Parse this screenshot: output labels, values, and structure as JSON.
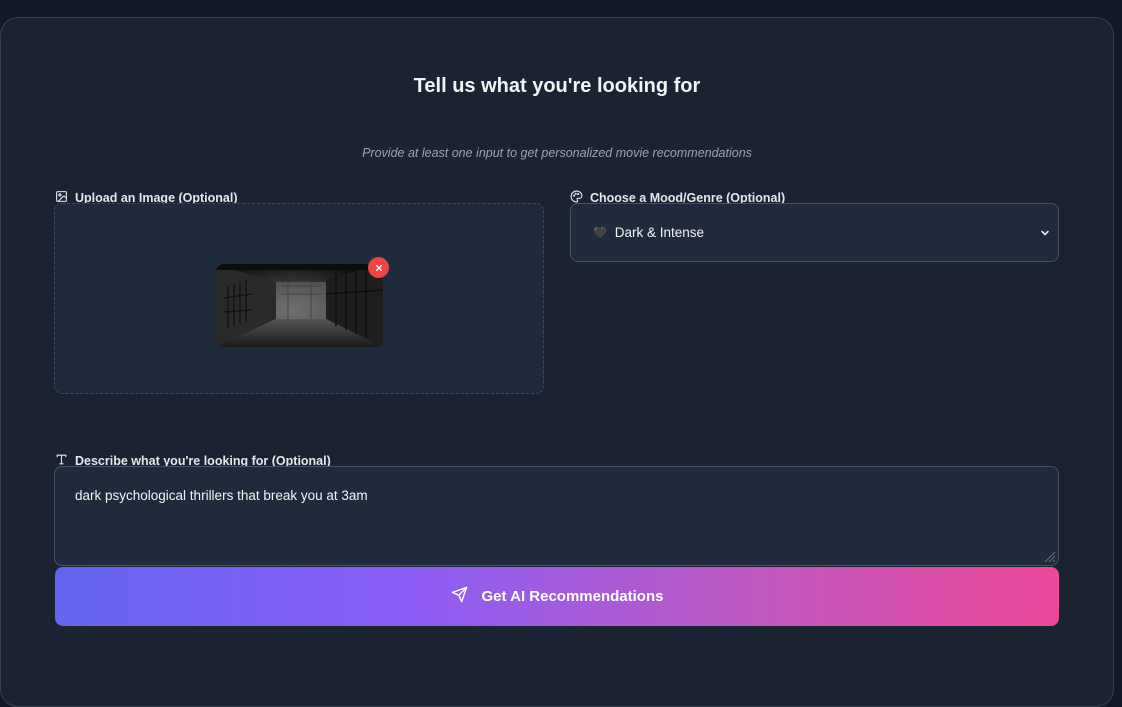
{
  "form": {
    "title": "Tell us what you're looking for",
    "subtitle": "Provide at least one input to get personalized movie recommendations"
  },
  "upload": {
    "label": "Upload an Image (Optional)",
    "icon": "image-icon",
    "has_image": true,
    "remove_icon": "close-icon"
  },
  "mood": {
    "label": "Choose a Mood/Genre (Optional)",
    "icon": "palette-icon",
    "selected_emoji": "🖤",
    "selected": "Dark & Intense"
  },
  "description": {
    "label": "Describe what you're looking for (Optional)",
    "icon": "text-icon",
    "value": "dark psychological thrillers that break you at 3am"
  },
  "submit": {
    "label": "Get AI Recommendations",
    "icon": "send-icon"
  },
  "colors": {
    "background": "#111827",
    "card": "#1b2333",
    "field": "#1f2a3c",
    "gradient_start": "#6366f1",
    "gradient_end": "#ec4899",
    "remove": "#ef4444"
  }
}
